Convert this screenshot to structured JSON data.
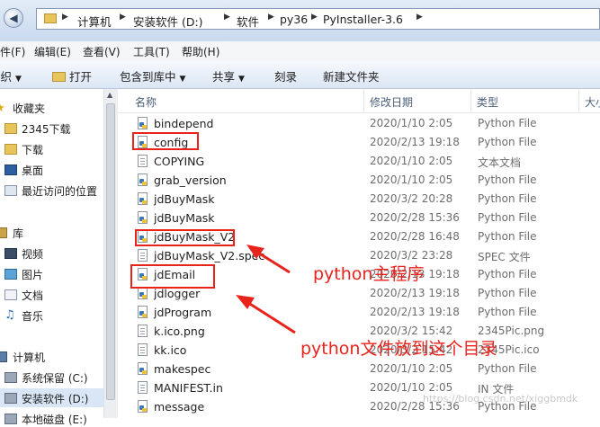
{
  "address_bar": {
    "back_icon": "left-arrow-icon",
    "breadcrumbs": [
      "计算机",
      "安装软件 (D:)",
      "软件",
      "py36",
      "PyInstaller-3.6"
    ]
  },
  "menu": [
    "件(F)",
    "编辑(E)",
    "查看(V)",
    "工具(T)",
    "帮助(H)"
  ],
  "toolbar": {
    "organize": "组织",
    "open": "打开",
    "include_library": "包含到库中",
    "share": "共享",
    "burn": "刻录",
    "new_folder": "新建文件夹"
  },
  "sidebar": {
    "favorites_header": "收藏夹",
    "favorites": [
      "2345下载",
      "下载",
      "桌面",
      "最近访问的位置"
    ],
    "libraries_header": "库",
    "libraries": [
      "视频",
      "图片",
      "文档",
      "音乐"
    ],
    "computer_header": "计算机",
    "drives": [
      "系统保留 (C:)",
      "安装软件 (D:)",
      "本地磁盘 (E:)"
    ]
  },
  "columns": {
    "name": "名称",
    "date": "修改日期",
    "type": "类型",
    "size": "大小"
  },
  "files": [
    {
      "name": "bindepend",
      "date": "2020/1/10 2:05",
      "type": "Python File",
      "icon": "py"
    },
    {
      "name": "config",
      "date": "2020/2/13 19:18",
      "type": "Python File",
      "icon": "py"
    },
    {
      "name": "COPYING",
      "date": "2020/1/10 2:05",
      "type": "文本文档",
      "icon": "txt"
    },
    {
      "name": "grab_version",
      "date": "2020/1/10 2:05",
      "type": "Python File",
      "icon": "py"
    },
    {
      "name": "jdBuyMask",
      "date": "2020/3/2 20:28",
      "type": "Python File",
      "icon": "py"
    },
    {
      "name": "jdBuyMask",
      "date": "2020/2/28 15:36",
      "type": "Python File",
      "icon": "py"
    },
    {
      "name": "jdBuyMask_V2",
      "date": "2020/2/28 16:48",
      "type": "Python File",
      "icon": "py"
    },
    {
      "name": "jdBuyMask_V2.spec",
      "date": "2020/3/2 23:28",
      "type": "SPEC 文件",
      "icon": "txt"
    },
    {
      "name": "jdEmail",
      "date": "2020/2/13 19:18",
      "type": "Python File",
      "icon": "py"
    },
    {
      "name": "jdlogger",
      "date": "2020/2/13 19:18",
      "type": "Python File",
      "icon": "py"
    },
    {
      "name": "jdProgram",
      "date": "2020/2/13 19:18",
      "type": "Python File",
      "icon": "py"
    },
    {
      "name": "k.ico.png",
      "date": "2020/3/2 15:42",
      "type": "2345Pic.png",
      "icon": "txt"
    },
    {
      "name": "kk.ico",
      "date": "2020/3/2 15:42",
      "type": "2345Pic.ico",
      "icon": "txt"
    },
    {
      "name": "makespec",
      "date": "2020/1/10 2:05",
      "type": "Python File",
      "icon": "py"
    },
    {
      "name": "MANIFEST.in",
      "date": "2020/1/10 2:05",
      "type": "IN 文件",
      "icon": "txt"
    },
    {
      "name": "message",
      "date": "2020/2/28 15:36",
      "type": "Python File",
      "icon": "py"
    }
  ],
  "annotations": {
    "main_program": "python主程序",
    "put_here": "python文件放到这个目录"
  },
  "watermark": "https://blog.csdn.net/xiggbmdk",
  "colors": {
    "annotation": "#e8231c",
    "folder": "#e8c55a",
    "py_blue": "#3c78b5",
    "py_yellow": "#f2c230"
  }
}
